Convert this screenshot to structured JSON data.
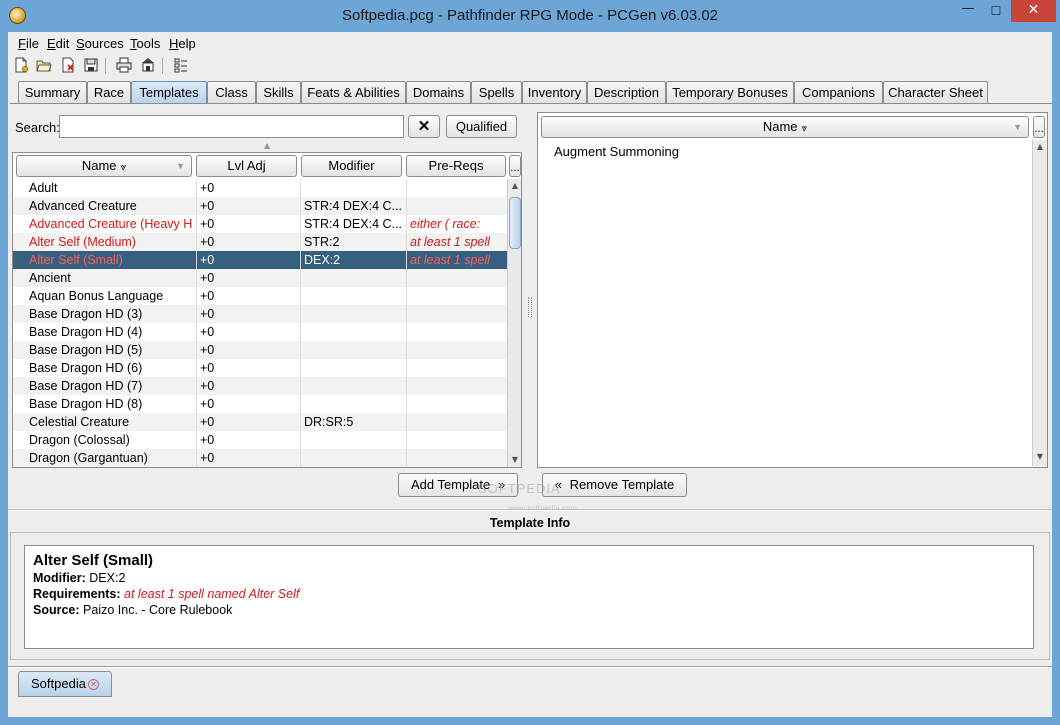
{
  "window": {
    "title": "Softpedia.pcg - Pathfinder RPG Mode - PCGen v6.03.02",
    "minimize_glyph": "—",
    "maximize_glyph": "☐",
    "close_glyph": "✕"
  },
  "menu": [
    "File",
    "Edit",
    "Sources",
    "Tools",
    "Help"
  ],
  "toolbar_icons": [
    "new-character-icon",
    "open-icon",
    "close-icon",
    "save-icon",
    "print-icon",
    "export-icon",
    "preferences-icon"
  ],
  "tabs": [
    {
      "label": "Summary"
    },
    {
      "label": "Race"
    },
    {
      "label": "Templates",
      "active": true
    },
    {
      "label": "Class"
    },
    {
      "label": "Skills"
    },
    {
      "label": "Feats & Abilities"
    },
    {
      "label": "Domains"
    },
    {
      "label": "Spells"
    },
    {
      "label": "Inventory"
    },
    {
      "label": "Description"
    },
    {
      "label": "Temporary Bonuses"
    },
    {
      "label": "Companions"
    },
    {
      "label": "Character Sheet"
    }
  ],
  "search": {
    "label": "Search:",
    "value": "",
    "clear_glyph": "✕",
    "qualified_label": "Qualified"
  },
  "available_table": {
    "columns": [
      "Name",
      "Lvl Adj",
      "Modifier",
      "Pre-Reqs"
    ],
    "more_glyph": "...",
    "rows": [
      {
        "name": "Adult",
        "lvl": "+0",
        "mod": "",
        "pre": ""
      },
      {
        "name": "Advanced Creature",
        "lvl": "+0",
        "mod": "STR:4 DEX:4 C...",
        "pre": ""
      },
      {
        "name": "Advanced Creature (Heavy Ho",
        "lvl": "+0",
        "mod": "STR:4 DEX:4 C...",
        "pre": "either ( race:",
        "red": true
      },
      {
        "name": "Alter Self (Medium)",
        "lvl": "+0",
        "mod": "STR:2",
        "pre": "at least 1 spell",
        "red": true
      },
      {
        "name": "Alter Self (Small)",
        "lvl": "+0",
        "mod": "DEX:2",
        "pre": "at least 1 spell",
        "red": true,
        "selected": true
      },
      {
        "name": "Ancient",
        "lvl": "+0",
        "mod": "",
        "pre": ""
      },
      {
        "name": "Aquan Bonus Language",
        "lvl": "+0",
        "mod": "",
        "pre": ""
      },
      {
        "name": "Base Dragon HD (3)",
        "lvl": "+0",
        "mod": "",
        "pre": ""
      },
      {
        "name": "Base Dragon HD (4)",
        "lvl": "+0",
        "mod": "",
        "pre": ""
      },
      {
        "name": "Base Dragon HD (5)",
        "lvl": "+0",
        "mod": "",
        "pre": ""
      },
      {
        "name": "Base Dragon HD (6)",
        "lvl": "+0",
        "mod": "",
        "pre": ""
      },
      {
        "name": "Base Dragon HD (7)",
        "lvl": "+0",
        "mod": "",
        "pre": ""
      },
      {
        "name": "Base Dragon HD (8)",
        "lvl": "+0",
        "mod": "",
        "pre": ""
      },
      {
        "name": "Celestial Creature",
        "lvl": "+0",
        "mod": "DR:SR:5",
        "pre": ""
      },
      {
        "name": "Dragon (Colossal)",
        "lvl": "+0",
        "mod": "",
        "pre": ""
      },
      {
        "name": "Dragon (Gargantuan)",
        "lvl": "+0",
        "mod": "",
        "pre": ""
      }
    ]
  },
  "selected_table": {
    "column": "Name",
    "more_glyph": "...",
    "items": [
      "Augment Summoning"
    ]
  },
  "buttons": {
    "add_template": "Add Template",
    "remove_template": "Remove Template"
  },
  "watermark": {
    "text": "SOFTPEDIA",
    "url": "www.softpedia.com"
  },
  "template_info": {
    "title": "Template Info",
    "name": "Alter Self (Small)",
    "modifier_label": "Modifier:",
    "modifier": "DEX:2",
    "requirements_label": "Requirements:",
    "requirements": "at least 1 spell named Alter Self",
    "source_label": "Source:",
    "source": "Paizo Inc. - Core Rulebook"
  },
  "character_tabs": [
    {
      "label": "Softpedia",
      "close_glyph": "✕"
    }
  ],
  "colors": {
    "titlebar": "#6ca5d6",
    "selection": "#36607f",
    "invalid_text": "#d21a1a",
    "close_button": "#c7443a"
  }
}
